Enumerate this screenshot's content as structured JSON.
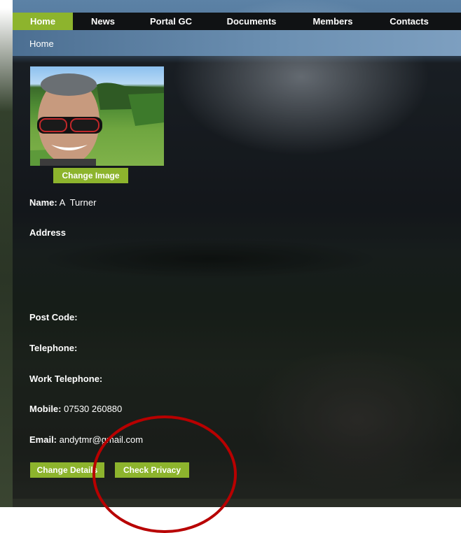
{
  "nav": {
    "items": [
      {
        "label": "Home",
        "active": true
      },
      {
        "label": "News",
        "active": false
      },
      {
        "label": "Portal GC",
        "active": false
      },
      {
        "label": "Documents",
        "active": false
      },
      {
        "label": "Members",
        "active": false
      },
      {
        "label": "Contacts",
        "active": false
      }
    ]
  },
  "breadcrumb": "Home",
  "profile": {
    "change_image_label": "Change Image",
    "name_label": "Name:",
    "name_value": "A  Turner",
    "address_label": "Address",
    "postcode_label": "Post Code:",
    "telephone_label": "Telephone:",
    "work_telephone_label": "Work Telephone:",
    "mobile_label": "Mobile:",
    "mobile_value": "07530 260880",
    "email_label": "Email:",
    "email_value": "andytmr@gmail.com",
    "change_details_label": "Change Details",
    "check_privacy_label": "Check Privacy"
  },
  "colors": {
    "accent": "#8db42d",
    "nav_bg": "#101214",
    "annotation": "#b80000"
  }
}
